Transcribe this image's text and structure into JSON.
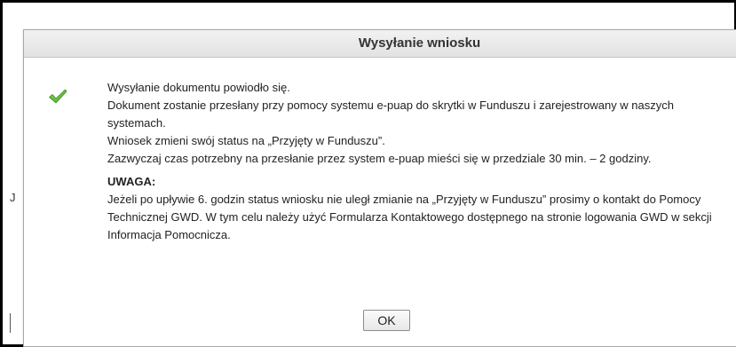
{
  "background": {
    "fragment": "J"
  },
  "dialog": {
    "title": "Wysyłanie wniosku",
    "status_icon": "checkmark-icon",
    "lines": [
      "Wysyłanie dokumentu powiodło się.",
      "Dokument zostanie przesłany przy pomocy systemu e-puap do skrytki w Funduszu i zarejestrowany w naszych systemach.",
      "Wniosek zmieni swój status na „Przyjęty w Funduszu”.",
      "Zazwyczaj czas potrzebny na przesłanie przez system e-puap mieści się w przedziale 30 min. – 2 godziny."
    ],
    "warning_label": "UWAGA:",
    "warning_text": "Jeżeli po upływie 6. godzin status wniosku nie uległ zmianie na „Przyjęty w Funduszu” prosimy o kontakt do Pomocy Technicznej GWD. W tym celu należy użyć Formularza Kontaktowego dostępnego na stronie logowania GWD w sekcji Informacja Pomocnicza.",
    "ok_label": "OK"
  },
  "colors": {
    "check_green": "#5cb435",
    "title_text": "#333333",
    "body_text": "#222222"
  }
}
